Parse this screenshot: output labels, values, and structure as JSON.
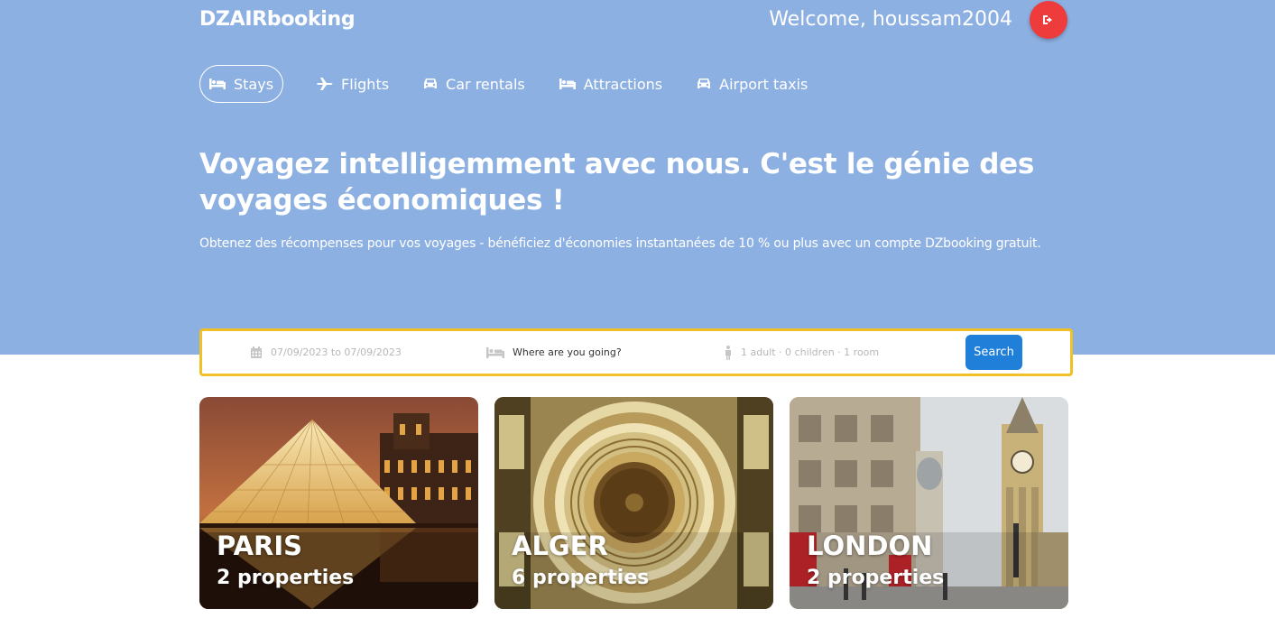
{
  "brand": "DZAIRbooking",
  "header": {
    "welcome": "Welcome, houssam2004",
    "logout_icon": "sign-out-icon"
  },
  "nav": [
    {
      "label": "Stays",
      "icon": "bed-icon",
      "active": true
    },
    {
      "label": "Flights",
      "icon": "plane-icon"
    },
    {
      "label": "Car rentals",
      "icon": "car-icon"
    },
    {
      "label": "Attractions",
      "icon": "bed-icon"
    },
    {
      "label": "Airport taxis",
      "icon": "taxi-icon"
    }
  ],
  "hero": {
    "title": "Voyagez intelligemment avec nous. C'est le génie des voyages économiques !",
    "subtitle": "Obtenez des récompenses pour vos voyages - bénéficiez d'économies instantanées de 10 % ou plus avec un compte DZbooking gratuit."
  },
  "search": {
    "dates": "07/09/2023 to 07/09/2023",
    "destination_placeholder": "Where are you going?",
    "guests": "1 adult · 0 children · 1 room",
    "button": "Search"
  },
  "featured": [
    {
      "city": "PARIS",
      "properties": "2 properties"
    },
    {
      "city": "ALGER",
      "properties": "6 properties"
    },
    {
      "city": "LONDON",
      "properties": "2 properties"
    }
  ],
  "colors": {
    "hero_bg": "#8db0e2",
    "accent_yellow": "#f0c027",
    "search_blue": "#1f7fd9",
    "logout_red": "#ee3b3b"
  }
}
